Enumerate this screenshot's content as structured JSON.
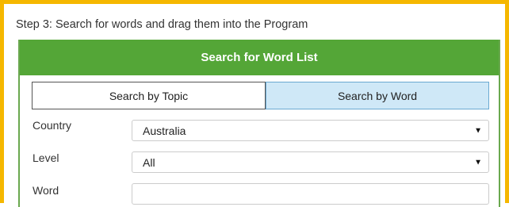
{
  "step_title": "Step 3: Search for words and drag them into the Program",
  "panel": {
    "header": "Search for Word List",
    "tabs": [
      {
        "label": "Search by Topic",
        "active": false
      },
      {
        "label": "Search by Word",
        "active": true
      }
    ],
    "fields": {
      "country": {
        "label": "Country",
        "value": "Australia"
      },
      "level": {
        "label": "Level",
        "value": "All"
      },
      "word": {
        "label": "Word",
        "value": ""
      }
    }
  },
  "colors": {
    "frame_border": "#f5b700",
    "header_bg": "#54a637",
    "active_tab_bg": "#cfe8f7"
  },
  "icons": {
    "dropdown": "caret-down-icon"
  }
}
